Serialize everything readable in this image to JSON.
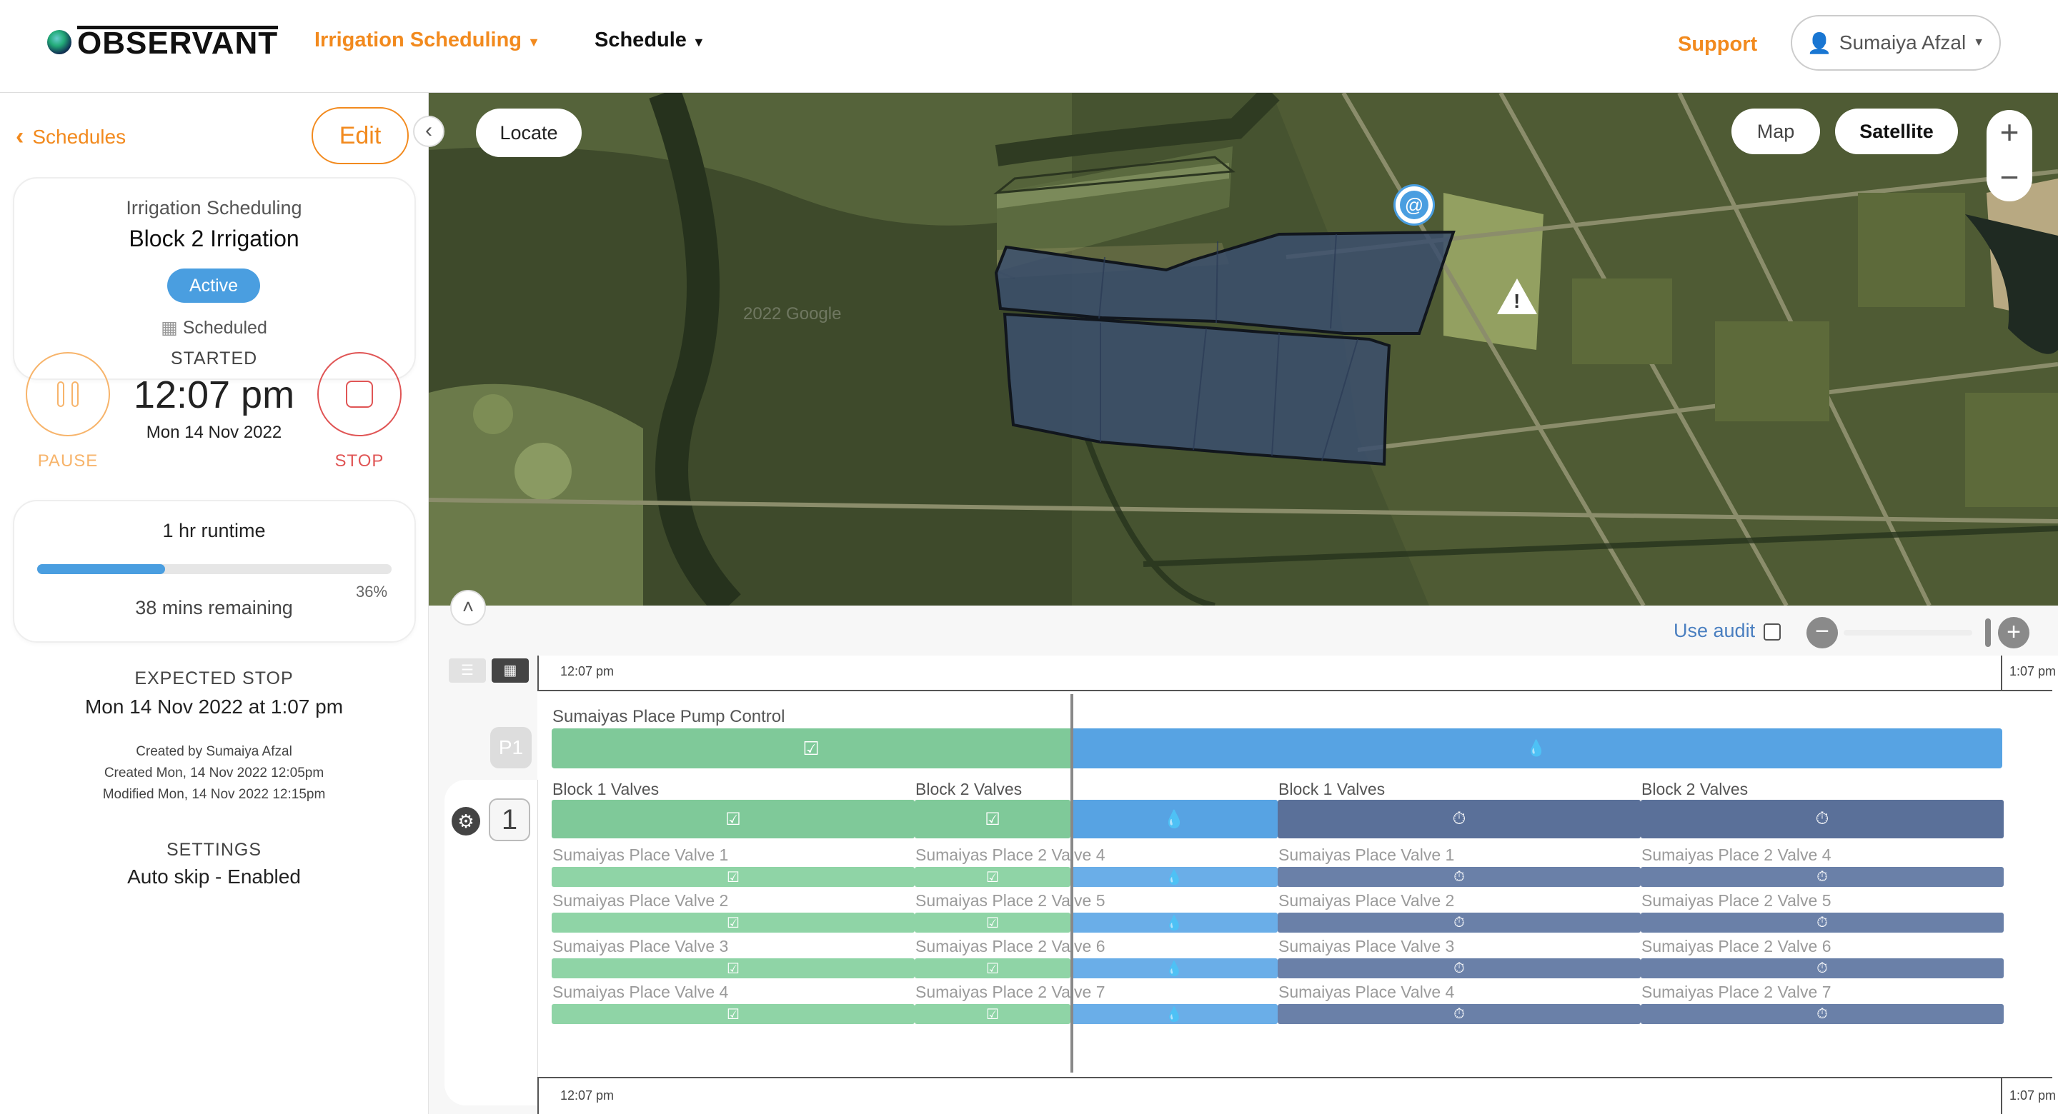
{
  "header": {
    "brand": "OBSERVANT",
    "nav_irrigation": "Irrigation Scheduling",
    "nav_schedule": "Schedule",
    "support": "Support",
    "user": "Sumaiya Afzal"
  },
  "sidebar": {
    "back_label": "Schedules",
    "edit_label": "Edit",
    "card_subtitle": "Irrigation Scheduling",
    "card_title": "Block 2 Irrigation",
    "status_badge": "Active",
    "scheduled_label": "Scheduled",
    "started_label": "STARTED",
    "started_time": "12:07 pm",
    "started_date": "Mon 14 Nov 2022",
    "pause_label": "PAUSE",
    "stop_label": "STOP",
    "runtime": "1 hr runtime",
    "progress_percent": "36%",
    "progress_fraction": 0.36,
    "remaining": "38 mins remaining",
    "expected_stop_label": "EXPECTED STOP",
    "expected_stop_value": "Mon 14 Nov 2022 at 1:07 pm",
    "created_by": "Created by Sumaiya Afzal",
    "created_on": "Created Mon, 14 Nov 2022 12:05pm",
    "modified_on": "Modified Mon, 14 Nov 2022 12:15pm",
    "settings_label": "SETTINGS",
    "settings_value": "Auto skip - Enabled"
  },
  "map": {
    "locate": "Locate",
    "map_tab": "Map",
    "satellite_tab": "Satellite",
    "watermark": "2022 Google"
  },
  "timeline": {
    "use_audit": "Use audit",
    "time_start": "12:07 pm",
    "time_end": "1:07 pm",
    "pump_label": "Sumaiyas Place Pump Control",
    "pump_badge": "P1",
    "group_badge": "1",
    "groups": [
      {
        "name": "Block 1 Valves",
        "valves": [
          "Sumaiyas Place Valve 1",
          "Sumaiyas Place Valve 2",
          "Sumaiyas Place Valve 3",
          "Sumaiyas Place Valve 4"
        ]
      },
      {
        "name": "Block 2 Valves",
        "valves": [
          "Sumaiyas Place 2 Valve 4",
          "Sumaiyas Place 2 Valve 5",
          "Sumaiyas Place 2 Valve 6",
          "Sumaiyas Place 2 Valve 7"
        ]
      },
      {
        "name": "Block 1 Valves",
        "valves": [
          "Sumaiyas Place Valve 1",
          "Sumaiyas Place Valve 2",
          "Sumaiyas Place Valve 3",
          "Sumaiyas Place Valve 4"
        ]
      },
      {
        "name": "Block 2 Valves",
        "valves": [
          "Sumaiyas Place 2 Valve 4",
          "Sumaiyas Place 2 Valve 5",
          "Sumaiyas Place 2 Valve 6",
          "Sumaiyas Place 2 Valve 7"
        ]
      }
    ]
  },
  "colors": {
    "accent": "#f28a1e",
    "complete": "#7fc999",
    "running": "#57a3e3",
    "pending": "#5a7099",
    "stop": "#e05555"
  }
}
